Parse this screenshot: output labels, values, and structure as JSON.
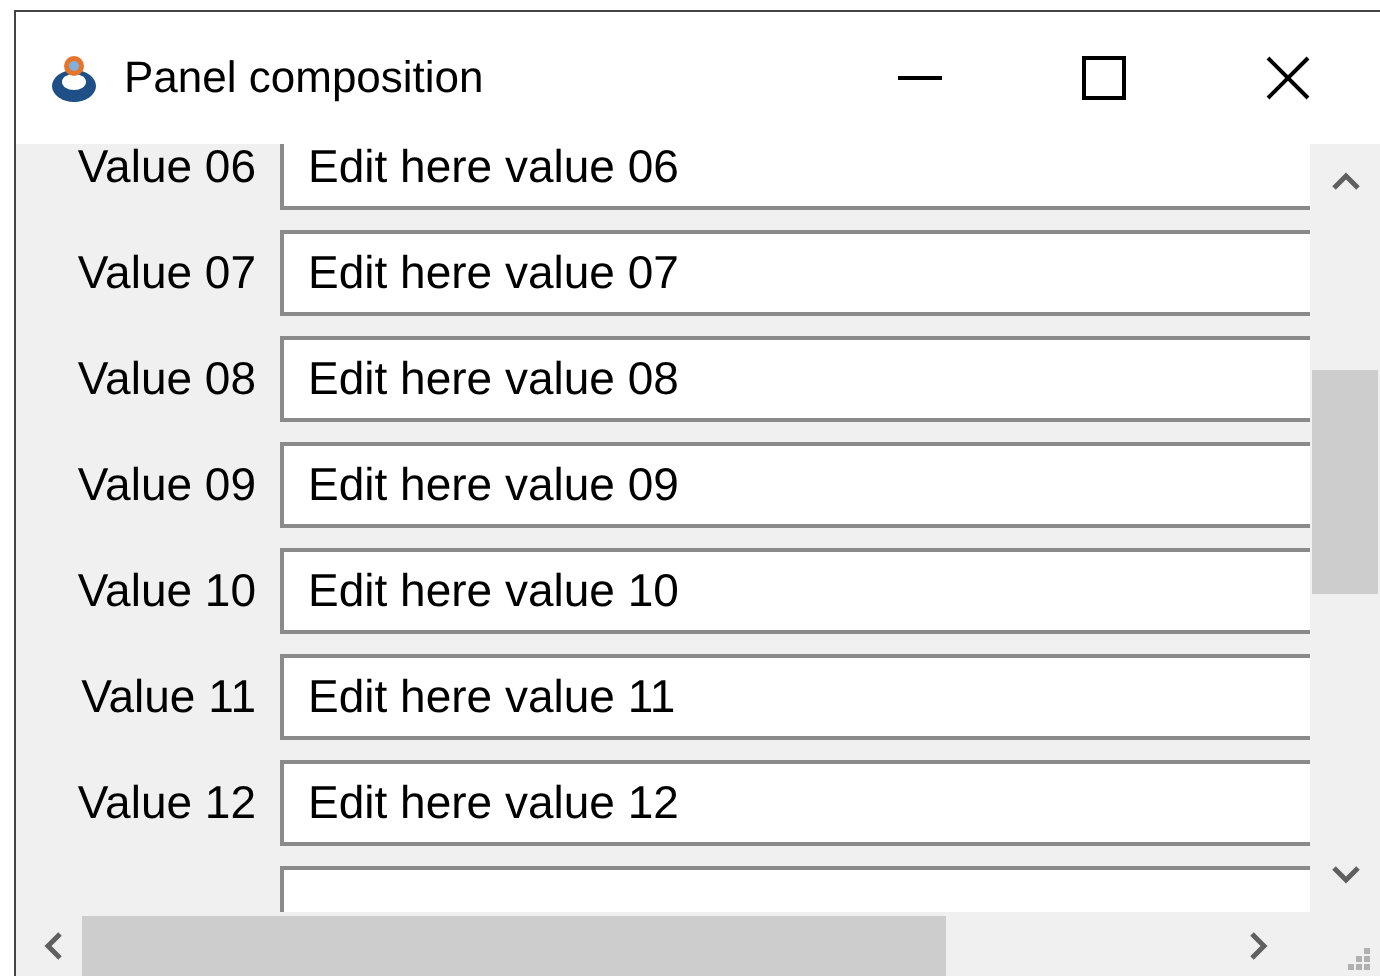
{
  "window": {
    "title": "Panel composition"
  },
  "fields": [
    {
      "label": "Value 06",
      "value": "Edit here value 06"
    },
    {
      "label": "Value 07",
      "value": "Edit here value 07"
    },
    {
      "label": "Value 08",
      "value": "Edit here value 08"
    },
    {
      "label": "Value 09",
      "value": "Edit here value 09"
    },
    {
      "label": "Value 10",
      "value": "Edit here value 10"
    },
    {
      "label": "Value 11",
      "value": "Edit here value 11"
    },
    {
      "label": "Value 12",
      "value": "Edit here value 12"
    }
  ]
}
